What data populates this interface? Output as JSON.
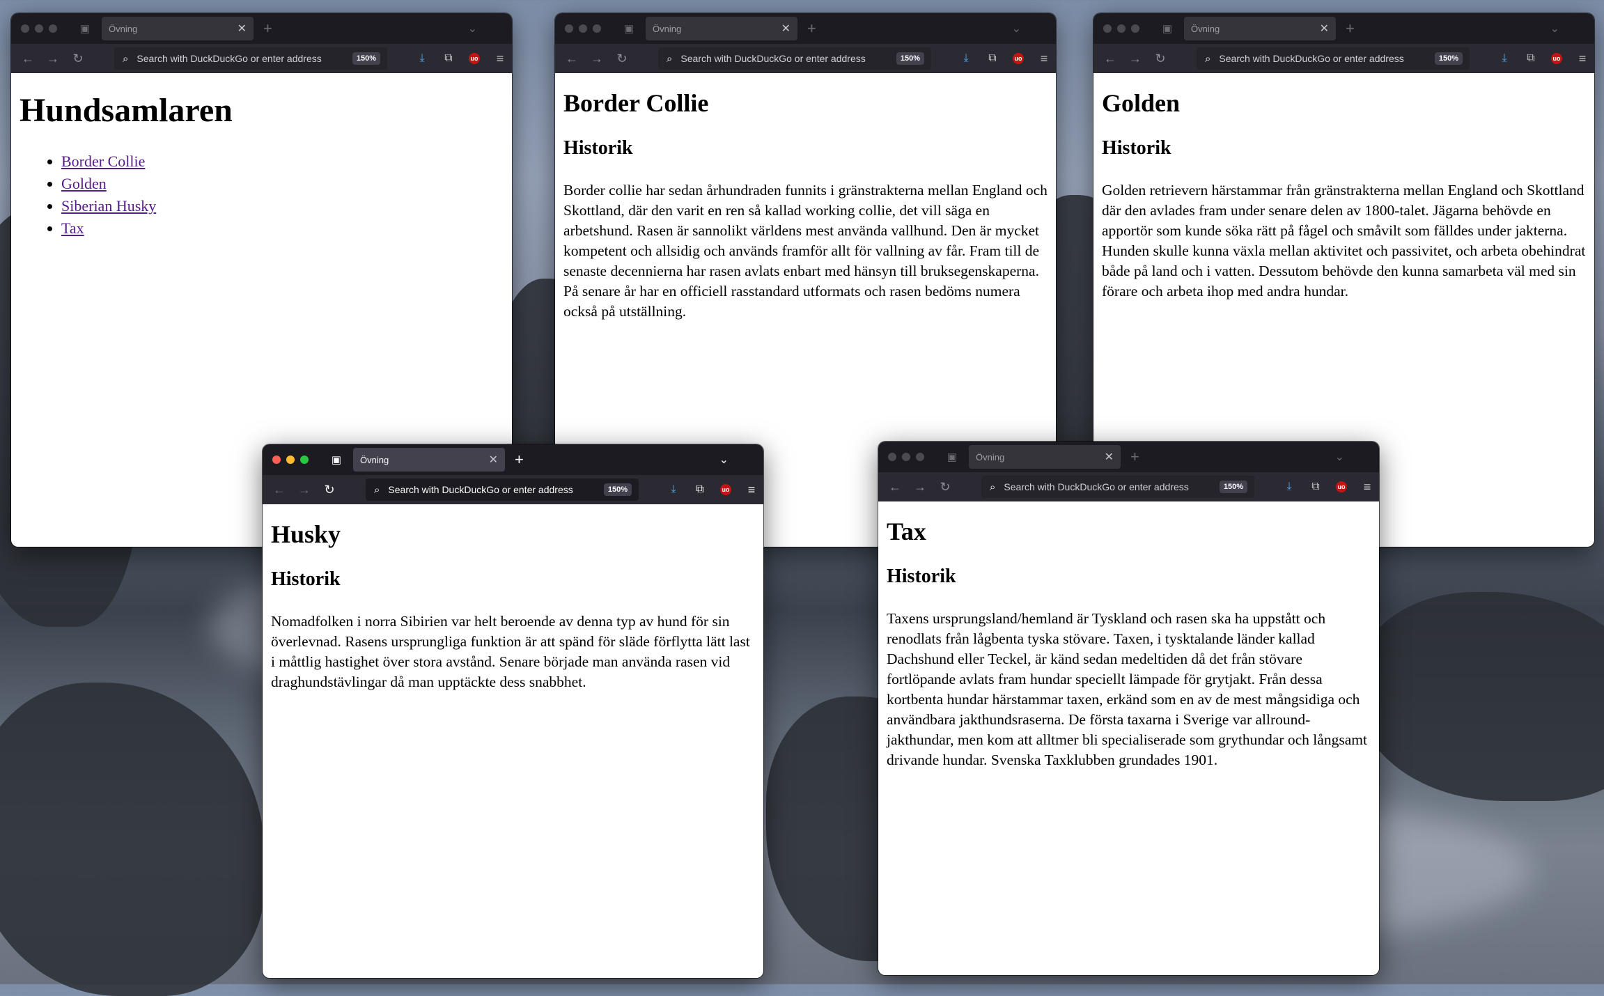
{
  "browser": {
    "tab_title": "Övning",
    "address_placeholder": "Search with DuckDuckGo or enter address",
    "zoom_level": "150%",
    "ublock_label": "uo"
  },
  "index_page": {
    "title": "Hundsamlaren",
    "links": [
      "Border Collie",
      "Golden",
      "Siberian Husky",
      "Tax"
    ]
  },
  "border_collie_page": {
    "title": "Border Collie",
    "section": "Historik",
    "text": "Border collie har sedan århundraden funnits i gränstrakterna mellan England och Skottland, där den varit en ren så kallad working collie, det vill säga en arbetshund. Rasen är sannolikt världens mest använda vallhund. Den är mycket kompetent och allsidig och används framför allt för vallning av får. Fram till de senaste decennierna har rasen avlats enbart med hänsyn till bruksegenskaperna. På senare år har en officiell rasstandard utformats och rasen bedöms numera också på utställning."
  },
  "golden_page": {
    "title": "Golden",
    "section": "Historik",
    "text": "Golden retrievern härstammar från gränstrakterna mellan England och Skottland där den avlades fram under senare delen av 1800-talet. Jägarna behövde en apportör som kunde söka rätt på fågel och småvilt som fälldes under jakterna. Hunden skulle kunna växla mellan aktivitet och passivitet, och arbeta obehindrat både på land och i vatten. Dessutom behövde den kunna samarbeta väl med sin förare och arbeta ihop med andra hundar."
  },
  "husky_page": {
    "title": "Husky",
    "section": "Historik",
    "text": "Nomadfolken i norra Sibirien var helt beroende av denna typ av hund för sin överlevnad. Rasens ursprungliga funktion är att spänd för släde förflytta lätt last i måttlig hastighet över stora avstånd. Senare började man använda rasen vid draghundstävlingar då man upptäckte dess snabbhet."
  },
  "tax_page": {
    "title": "Tax",
    "section": "Historik",
    "text": "Taxens ursprungsland/hemland är Tyskland och rasen ska ha uppstått och renodlats från lågbenta tyska stövare. Taxen, i tysktalande länder kallad Dachshund eller Teckel, är känd sedan medeltiden då det från stövare fortlöpande avlats fram hundar speciellt lämpade för grytjakt. Från dessa kortbenta hundar härstammar taxen, erkänd som en av de mest mångsidiga och användbara jakthundsraserna. De första taxarna i Sverige var allround-jakthundar, men kom att alltmer bli specialiserade som grythundar och långsamt drivande hundar. Svenska Taxklubben grundades 1901."
  },
  "icons": {
    "back": "arrow-left-icon",
    "forward": "arrow-right-icon",
    "reload": "reload-icon",
    "search": "search-icon",
    "download": "download-icon",
    "extensions": "puzzle-icon",
    "ublock": "ublock-icon",
    "menu": "hamburger-menu-icon",
    "tab_list": "chevron-down-icon",
    "new_tab": "plus-icon",
    "tab_close": "close-icon",
    "firefox_view": "firefox-view-icon"
  },
  "colors": {
    "chrome_dark": "#1c1b22",
    "toolbar": "#2b2a33",
    "link_visited": "#551a8b",
    "download_accent": "#4ca3e8",
    "ublock_red": "#c41414"
  }
}
